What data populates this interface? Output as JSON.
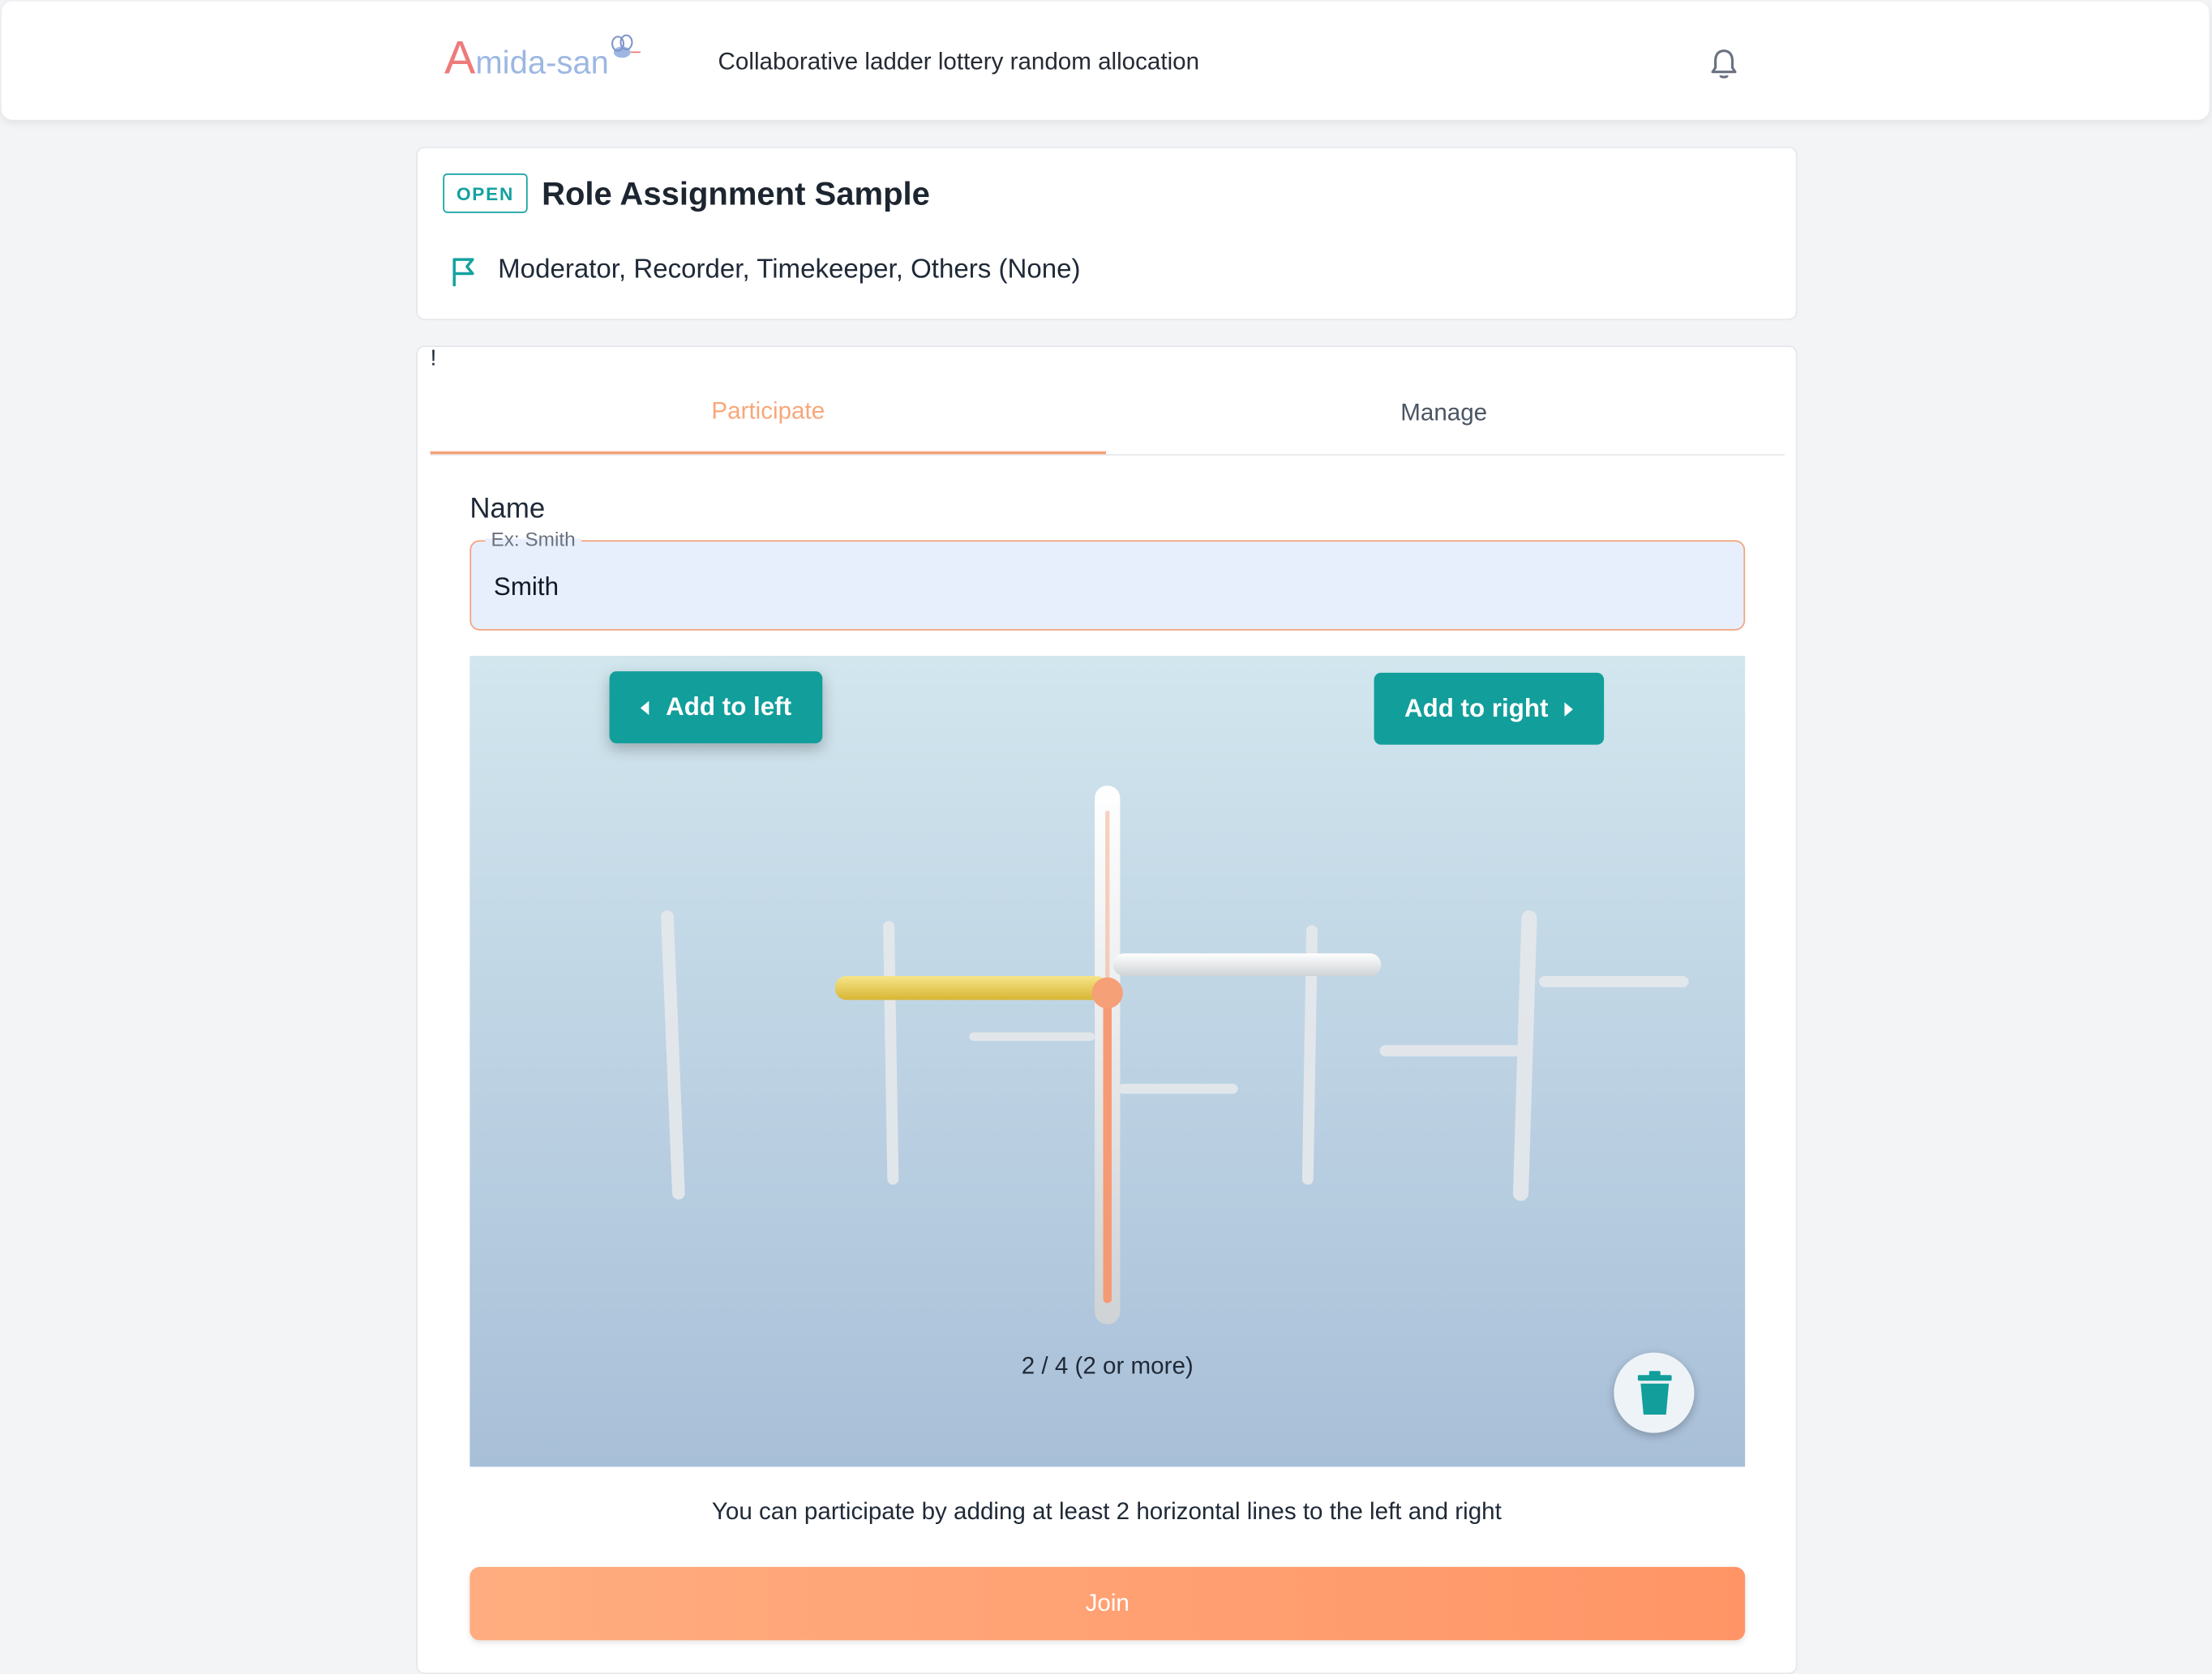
{
  "header": {
    "logo_initial": "A",
    "logo_rest": "mida-san",
    "tagline": "Collaborative ladder lottery random allocation",
    "bell_icon": "bell-icon"
  },
  "event": {
    "status": "OPEN",
    "title": "Role Assignment Sample",
    "flag_icon": "flag-icon",
    "roles": "Moderator, Recorder, Timekeeper, Others (None)"
  },
  "tabs": {
    "participate": "Participate",
    "manage": "Manage",
    "manage_alert": "!"
  },
  "form": {
    "name_label": "Name",
    "name_placeholder": "Ex: Smith",
    "name_value": "Smith"
  },
  "ladder": {
    "add_left": "Add to left",
    "add_right": "Add to right",
    "count_text": "2 / 4 (2 or more)",
    "trash_icon": "trash-icon"
  },
  "hint": "You can participate by adding at least 2 horizontal lines to the left and right",
  "join_label": "Join",
  "colors": {
    "accent": "#14a1a1",
    "orange": "#f6a078",
    "yellow": "#e8c840"
  }
}
